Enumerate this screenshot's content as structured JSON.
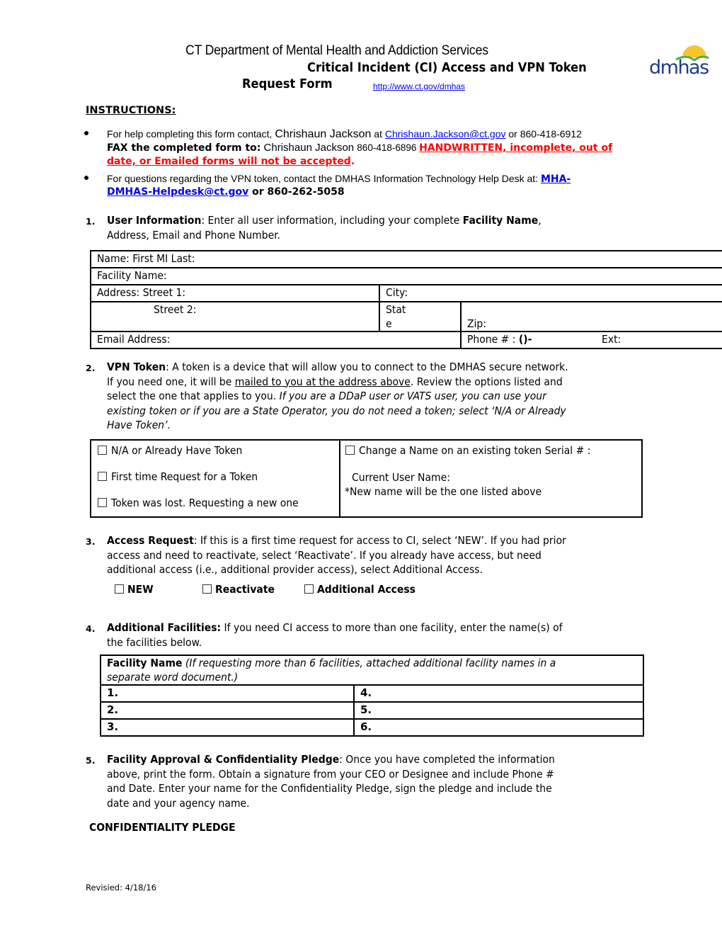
{
  "header": {
    "department": "CT Department of Mental Health and Addiction Services",
    "title_line1": "Critical Incident (CI) Access and VPN Token",
    "title_line2": "Request Form",
    "url": "http://www.ct.gov/dmhas",
    "logo_text": "dmhas",
    "logo_colors": {
      "sun": "#f7c42b",
      "hill": "#4caf50",
      "text": "#1f3c88"
    }
  },
  "instructions": {
    "heading": "INSTRUCTIONS:",
    "bullet1": {
      "prefix": "For help completing this form contact, ",
      "contact_name": "Chrishaun Jackson",
      "at": " at ",
      "email": "Chrishaun.Jackson@ct.gov",
      "phone": " or 860-418-6912",
      "fax_label": "FAX the completed form to:",
      "fax_name": " Chrishaun Jackson ",
      "fax_number": "860-418-6896 ",
      "warning_1": "HANDWRITTEN, incomplete, out of",
      "warning_2": "date, or Emailed forms will not be accepted",
      "warning_dot": "."
    },
    "bullet2": {
      "text": "For questions regarding the VPN token, contact the DMHAS Information Technology Help Desk at: ",
      "email_1": "MHA-",
      "email_2": "DMHAS-Helpdesk@ct.gov",
      "phone": " or 860-262-5058"
    }
  },
  "section1": {
    "number": "1.",
    "title": "User Information",
    "text_a": ": Enter all user information, including your complete ",
    "bold_b": "Facility Name",
    "text_c": ",",
    "line2": "Address, Email and Phone Number.",
    "fields": {
      "name": "Name:  First MI Last:",
      "facility": "Facility Name:",
      "street1": "Address:  Street 1:",
      "city": "City:",
      "street2": "Street 2:",
      "state_1": "Stat",
      "state_2": "e",
      "zip": "Zip:",
      "email": "Email Address:",
      "phone_label": "Phone # : ",
      "phone_mask": "()-",
      "ext": "Ext:"
    }
  },
  "section2": {
    "number": "2.",
    "title": "VPN Token",
    "line1": ": A token is a device that will allow you to connect to the DMHAS secure network.",
    "line2_a": "If you need one, it will be ",
    "line2_u": "mailed to you at the address above",
    "line2_b": ". Review the options listed and",
    "line3_a": "select the one that applies to you.  ",
    "line3_i": "If you are a DDaP user or VATS user, you can use your",
    "line4": "existing token or if you are a State Operator, you do not need a token; select ‘N/A or Already",
    "line5": "Have Token’.",
    "options": [
      {
        "label": "N/A or Already Have Token",
        "checked": false
      },
      {
        "label": "First time Request for a Token",
        "checked": false
      },
      {
        "label": "Token was lost. Requesting a new one",
        "checked": false
      }
    ],
    "change_option": {
      "label": "Change a Name on an existing token Serial #  :",
      "checked": false
    },
    "current_user": "Current User Name:",
    "note": "*New name will be the one listed above"
  },
  "section3": {
    "number": "3.",
    "title": "Access Request",
    "line1": ": If this is a first time request for access to CI, select ‘NEW’.  If you had prior",
    "line2": "access and need to reactivate, select ‘Reactivate’.  If you already have access, but need",
    "line3": "additional access (i.e., additional provider access), select Additional Access.",
    "options": [
      {
        "label": "NEW",
        "checked": false
      },
      {
        "label": "Reactivate",
        "checked": false
      },
      {
        "label": "Additional Access",
        "checked": false
      }
    ]
  },
  "section4": {
    "number": "4.",
    "title": "Additional Facilities:",
    "line1": " If you need CI access to more than one facility, enter the name(s) of",
    "line2": "the facilities below.",
    "table_header_bold": "Facility Name",
    "table_header_italic_1": " (If requesting more than 6 facilities, attached additional facility names in a",
    "table_header_italic_2": "separate word document.)",
    "rows": [
      [
        "1.",
        "4."
      ],
      [
        "2.",
        "5."
      ],
      [
        "3.",
        "6."
      ]
    ]
  },
  "section5": {
    "number": "5.",
    "title": "Facility Approval & Confidentiality Pledge",
    "line1": ":  Once you have completed the information",
    "line2": "above, print the form.  Obtain a signature from your CEO or Designee and include Phone #",
    "line3": "and Date. Enter your name for the Confidentiality Pledge, sign the pledge and include the",
    "line4": "date and your agency name."
  },
  "pledge_heading": "CONFIDENTIALITY PLEDGE",
  "footer": {
    "revised": "Revisied: 4/18/16"
  }
}
